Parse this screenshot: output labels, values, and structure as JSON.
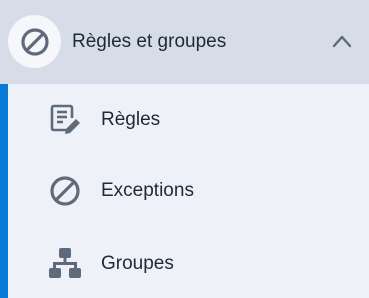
{
  "group": {
    "label": "Règles et groupes",
    "icon": "block-icon",
    "expanded": true
  },
  "items": [
    {
      "label": "Règles",
      "icon": "rule-edit-icon"
    },
    {
      "label": "Exceptions",
      "icon": "block-icon"
    },
    {
      "label": "Groupes",
      "icon": "hierarchy-icon"
    }
  ],
  "colors": {
    "header_bg": "#d6dde8",
    "panel_bg": "#eef2f8",
    "accent": "#0a7ad6",
    "icon": "#5f6b7a",
    "text": "#1f2937"
  }
}
